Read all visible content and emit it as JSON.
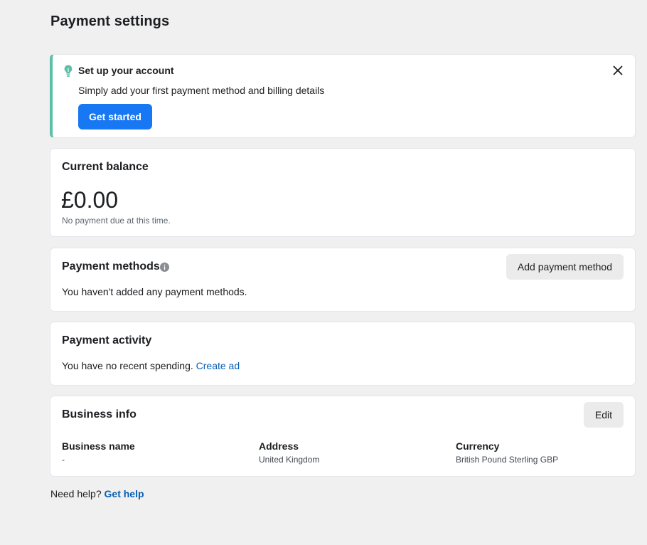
{
  "page": {
    "title": "Payment settings"
  },
  "setup": {
    "title": "Set up your account",
    "description": "Simply add your first payment method and billing details",
    "button_label": "Get started",
    "icon": "lightbulb-icon",
    "accent_color": "#5ebfa8",
    "close_icon": "close-icon"
  },
  "balance": {
    "title": "Current balance",
    "amount": "£0.00",
    "note": "No payment due at this time."
  },
  "payment_methods": {
    "title": "Payment methods",
    "info_icon": "info-icon",
    "add_button": "Add payment method",
    "empty_text": "You haven't added any payment methods."
  },
  "activity": {
    "title": "Payment activity",
    "text": "You have no recent spending.",
    "link": "Create ad"
  },
  "business": {
    "title": "Business info",
    "edit_button": "Edit",
    "columns": [
      {
        "label": "Business name",
        "value": "-"
      },
      {
        "label": "Address",
        "value": "United Kingdom"
      },
      {
        "label": "Currency",
        "value": "British Pound Sterling GBP"
      }
    ]
  },
  "help": {
    "text": "Need help?",
    "link": "Get help"
  },
  "colors": {
    "primary": "#1877f2",
    "link": "#0a5fb4",
    "background": "#f0f0f0"
  }
}
